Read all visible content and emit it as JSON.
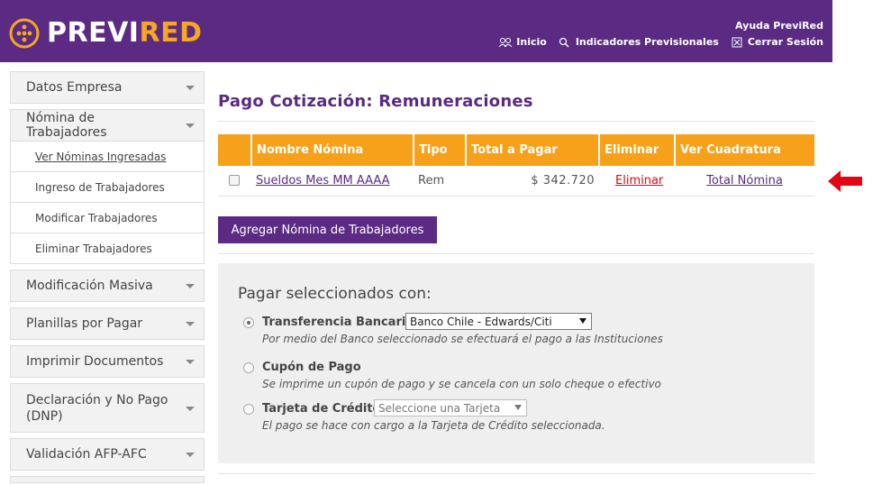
{
  "header": {
    "logo_prefix": "PREVI",
    "logo_suffix": "RED",
    "help_label": "Ayuda PreviRed",
    "nav": [
      {
        "label": "Inicio",
        "icon": "users-icon"
      },
      {
        "label": "Indicadores Previsionales",
        "icon": "search-icon"
      },
      {
        "label": "Cerrar Sesión",
        "icon": "close-box-icon"
      }
    ]
  },
  "sidebar": {
    "datos_empresa": "Datos Empresa",
    "nomina": "Nómina de Trabajadores",
    "sub": [
      "Ver Nóminas Ingresadas",
      "Ingreso de Trabajadores",
      "Modificar Trabajadores",
      "Eliminar Trabajadores"
    ],
    "modificacion": "Modificación Masiva",
    "planillas": "Planillas por Pagar",
    "imprimir": "Imprimir Documentos",
    "declaracion": "Declaración y No Pago (DNP)",
    "validacion": "Validación AFP-AFC"
  },
  "main": {
    "title": "Pago Cotización: Remuneraciones",
    "table": {
      "headers": [
        "Nombre Nómina",
        "Tipo",
        "Total a Pagar",
        "Eliminar",
        "Ver Cuadratura"
      ],
      "row": {
        "nombre": "Sueldos Mes MM AAAA",
        "tipo": "Rem",
        "total": "$ 342.720",
        "eliminar": "Eliminar",
        "cuadratura": "Total Nómina"
      }
    },
    "add_button": "Agregar Nómina de Trabajadores",
    "pay": {
      "title": "Pagar seleccionados con:",
      "transferencia": {
        "label": "Transferencia Bancaria",
        "bank": "Banco Chile - Edwards/Citi",
        "desc": "Por medio del Banco seleccionado se efectuará el pago a las Instituciones"
      },
      "cupon": {
        "label": "Cupón de Pago",
        "desc": "Se imprime un cupón de pago y se cancela con un solo cheque o efectivo"
      },
      "tarjeta": {
        "label": "Tarjeta de Crédito",
        "select": "Seleccione una Tarjeta",
        "desc": "El pago se hace con cargo a la Tarjeta de Crédito seleccionada."
      }
    }
  },
  "colors": {
    "purple": "#5b2a83",
    "orange": "#f7a11a",
    "red": "#e30613"
  }
}
